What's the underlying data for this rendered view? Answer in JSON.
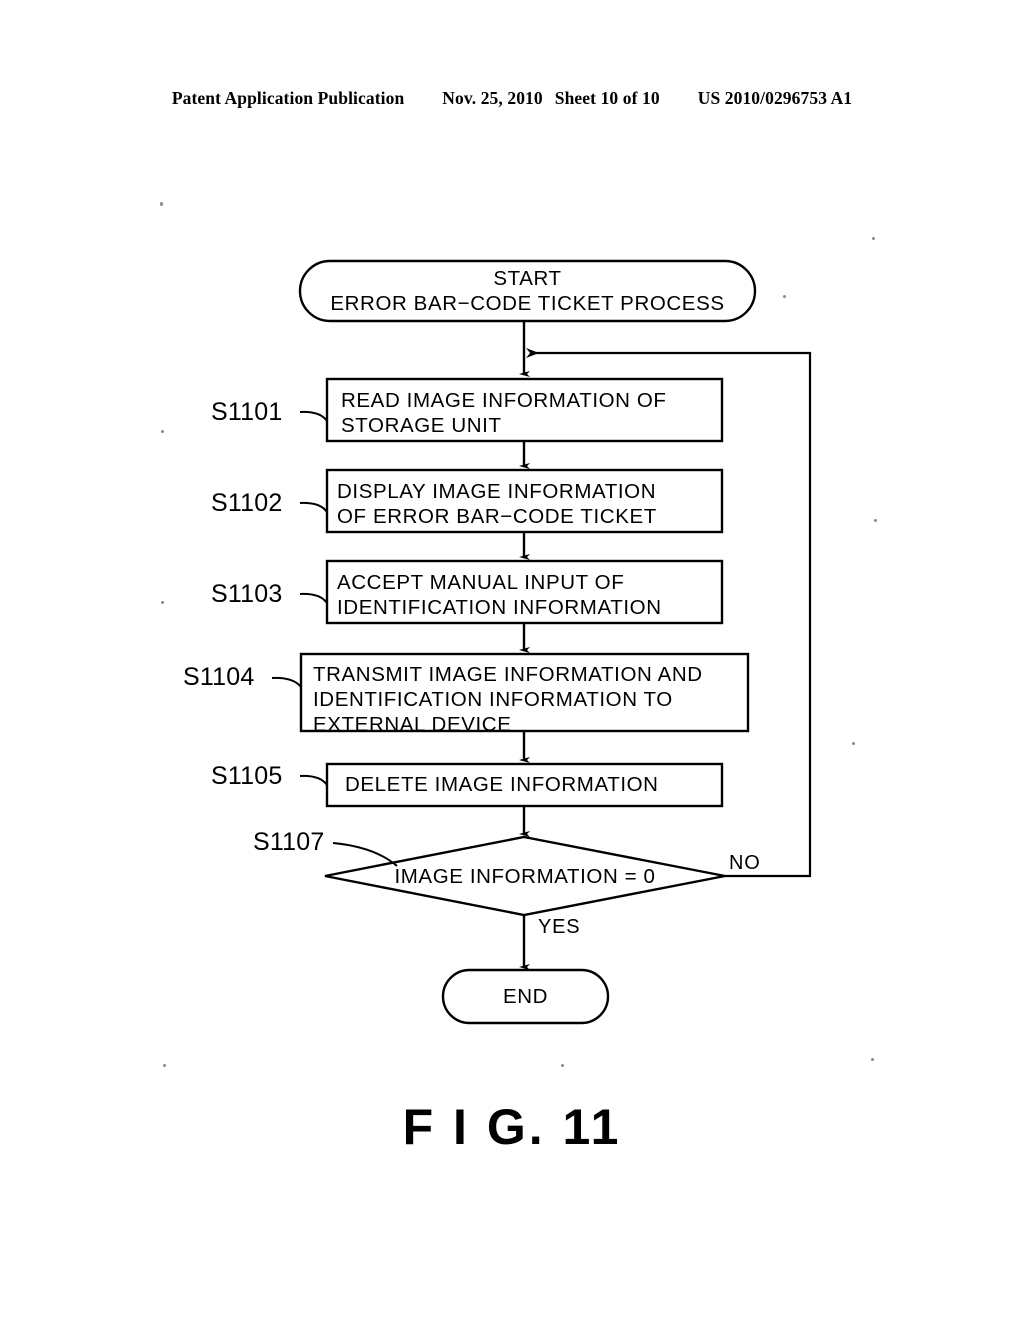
{
  "header": {
    "publication": "Patent Application Publication",
    "date": "Nov. 25, 2010",
    "sheet": "Sheet 10 of 10",
    "patent_number": "US 2010/0296753 A1"
  },
  "figure": {
    "caption": "F I G. 11"
  },
  "flowchart": {
    "start": {
      "step_id": "",
      "line1": "START",
      "line2": "ERROR  BAR−CODE  TICKET  PROCESS"
    },
    "steps": [
      {
        "step_id": "S1101",
        "lines": [
          "READ  IMAGE  INFORMATION  OF",
          "STORAGE  UNIT"
        ]
      },
      {
        "step_id": "S1102",
        "lines": [
          "DISPLAY  IMAGE  INFORMATION",
          "OF  ERROR  BAR−CODE  TICKET"
        ]
      },
      {
        "step_id": "S1103",
        "lines": [
          "ACCEPT  MANUAL  INPUT  OF",
          "IDENTIFICATION   INFORMATION"
        ]
      },
      {
        "step_id": "S1104",
        "lines": [
          "TRANSMIT  IMAGE  INFORMATION  AND",
          "IDENTIFICATION  INFORMATION  TO",
          "EXTERNAL  DEVICE"
        ]
      },
      {
        "step_id": "S1105",
        "lines": [
          "DELETE  IMAGE  INFORMATION"
        ]
      }
    ],
    "decision": {
      "step_id": "S1107",
      "text": "IMAGE  INFORMATION   = 0",
      "branch_no": "NO",
      "branch_yes": "YES"
    },
    "end": {
      "label": "END"
    }
  },
  "colors": {
    "ink": "#000000",
    "paper": "#ffffff"
  }
}
